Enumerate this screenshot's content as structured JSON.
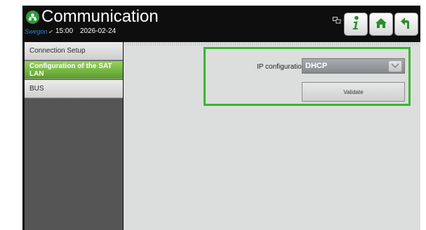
{
  "header": {
    "title": "Communication",
    "brand": "Swegon",
    "time": "15:00",
    "date": "2026-02-24",
    "icons": {
      "app": "communication-icon",
      "status_network": "network-icon",
      "status_user": "user-status-icon",
      "info": "info-icon",
      "home": "home-icon",
      "back": "back-arrow-icon"
    }
  },
  "sidebar": {
    "items": [
      {
        "label": "Connection Setup",
        "active": false
      },
      {
        "label": "Configuration of the SAT LAN",
        "active": true
      },
      {
        "label": "BUS",
        "active": false
      }
    ]
  },
  "main": {
    "ip_label": "IP configuration",
    "ip_value": "DHCP",
    "validate_label": "Validate"
  },
  "colors": {
    "accent_green": "#38b52f",
    "brand_blue": "#2a86d4",
    "background": "#0e0e0e",
    "content_bg": "#dcdedd"
  }
}
